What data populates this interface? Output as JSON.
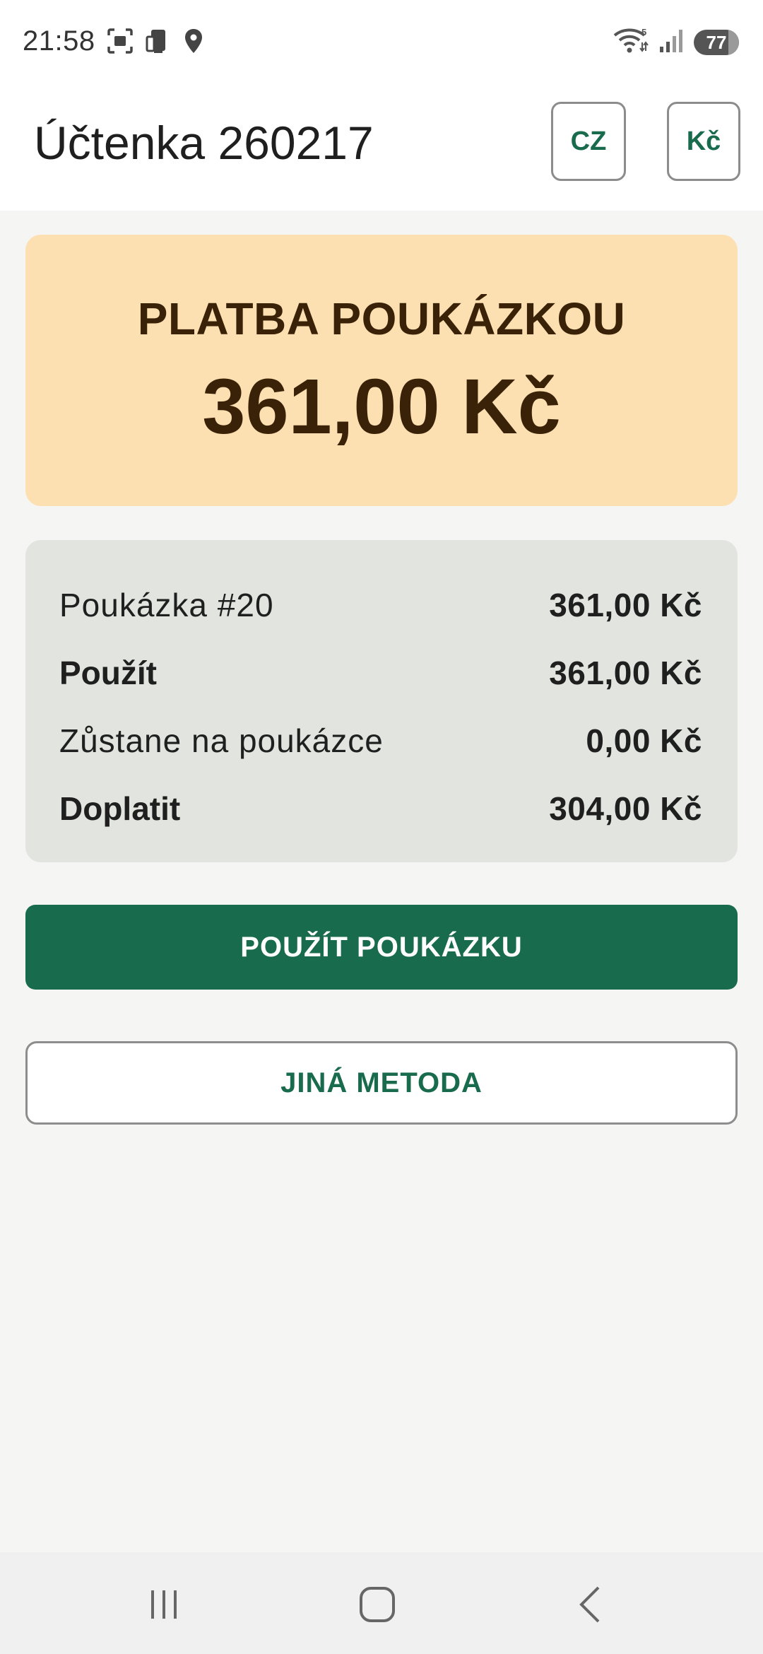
{
  "status_bar": {
    "time": "21:58",
    "battery": "77",
    "battery_level_percent": 77,
    "icons_left": [
      "screenshot-icon",
      "device-icon",
      "location-icon"
    ],
    "icons_right": [
      "wifi-icon",
      "signal-icon",
      "battery-icon"
    ]
  },
  "header": {
    "title": "Účtenka 260217",
    "language_label": "CZ",
    "currency_label": "Kč"
  },
  "banner": {
    "title": "PLATBA POUKÁZKOU",
    "amount": "361,00 Kč"
  },
  "summary": {
    "rows": [
      {
        "label": "Poukázka #20",
        "value": "361,00 Kč"
      },
      {
        "label": "Použít",
        "value": "361,00 Kč"
      },
      {
        "label": "Zůstane na poukázce",
        "value": "0,00 Kč"
      },
      {
        "label": "Doplatit",
        "value": "304,00 Kč"
      }
    ]
  },
  "actions": {
    "primary_label": "POUŽÍT POUKÁZKU",
    "secondary_label": "JINÁ METODA"
  },
  "colors": {
    "accent": "#196b4e",
    "banner_bg": "#fde0b2",
    "banner_text": "#3a2208",
    "summary_bg": "#e2e4df"
  }
}
